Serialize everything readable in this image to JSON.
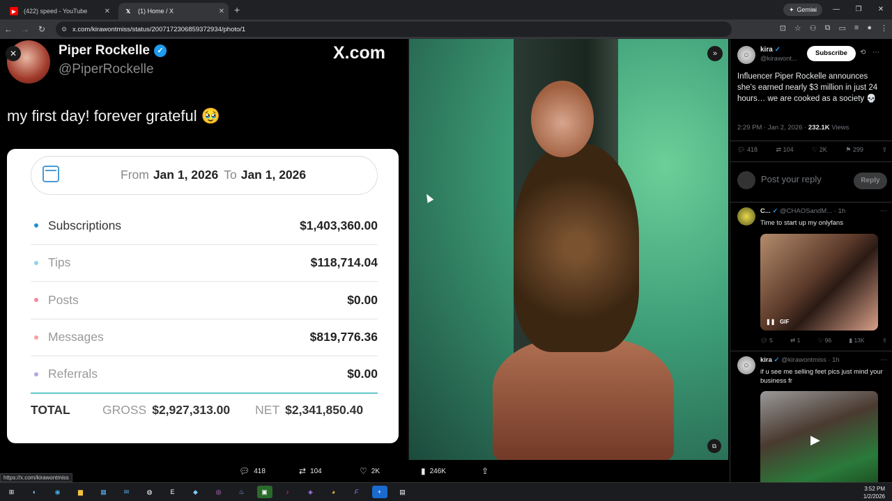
{
  "browser": {
    "tabs": [
      {
        "label": "(422) speed - YouTube",
        "icon": "youtube-icon"
      },
      {
        "label": "(1) Home / X",
        "icon": "x-icon"
      }
    ],
    "gemini_label": "Gemini",
    "url": "x.com/kirawontmiss/status/2007172306859372934/photo/1",
    "status_url": "https://x.com/kirawontmiss"
  },
  "left_image": {
    "author_name": "Piper Rockelle",
    "author_handle": "@PiperRockelle",
    "watermark": "X.com",
    "text": "my first day! forever grateful 🥹",
    "date_from_label": "From",
    "date_from": "Jan 1, 2026",
    "date_to_label": "To",
    "date_to": "Jan 1, 2026",
    "rows": [
      {
        "name": "Subscriptions",
        "amount": "$1,403,360.00",
        "color": "#1f8fd6"
      },
      {
        "name": "Tips",
        "amount": "$118,714.04",
        "color": "#8fd3e8"
      },
      {
        "name": "Posts",
        "amount": "$0.00",
        "color": "#f28aa0"
      },
      {
        "name": "Messages",
        "amount": "$819,776.36",
        "color": "#f7a0a0"
      },
      {
        "name": "Referrals",
        "amount": "$0.00",
        "color": "#b3a6e6"
      }
    ],
    "total_label": "TOTAL",
    "gross_label": "GROSS",
    "gross": "$2,927,313.00",
    "net_label": "NET",
    "net": "$2,341,850.40"
  },
  "photo_actions": {
    "replies": "418",
    "reposts": "104",
    "likes": "2K",
    "views": "246K"
  },
  "sidebar": {
    "author_name": "kira",
    "author_handle": "@kirawont...",
    "subscribe_label": "Subscribe",
    "tweet_text": "Influencer Piper Rockelle announces she’s earned nearly $3 million in just 24 hours… we are cooked as a society 💀",
    "time": "2:29 PM · Jan 2, 2026 ·",
    "views_count": "232.1K",
    "views_label": "Views",
    "stats": {
      "replies": "418",
      "reposts": "104",
      "likes": "2K",
      "bookmarks": "299"
    },
    "reply_placeholder": "Post your reply",
    "reply_button": "Reply",
    "posts": [
      {
        "name": "C...",
        "handle": "@CHAOSandM...",
        "age": "· 1h",
        "text": "Time to start up my onlyfans",
        "badge": "GIF",
        "stats": {
          "replies": "5",
          "reposts": "1",
          "likes": "96",
          "views": "13K"
        }
      },
      {
        "name": "kira",
        "handle": "@kirawontmiss",
        "age": "· 1h",
        "text": "if u see me selling feet pics just mind your business fr"
      }
    ]
  },
  "taskbar": {
    "time": "3:52 PM",
    "date": "1/2/2026"
  }
}
